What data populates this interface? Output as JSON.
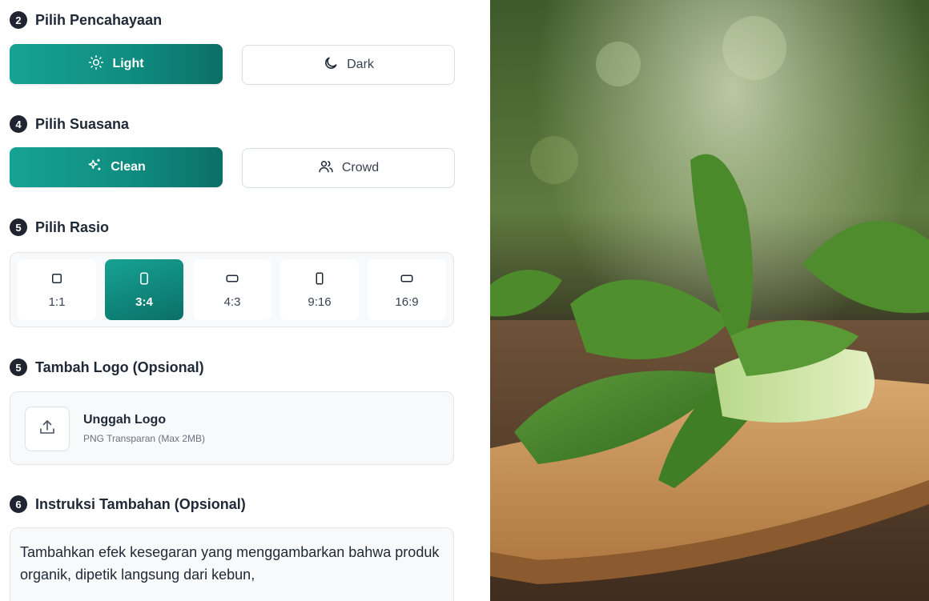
{
  "lighting": {
    "number": "2",
    "title": "Pilih Pencahayaan",
    "options": [
      {
        "label": "Light",
        "icon": "sun-icon",
        "selected": true
      },
      {
        "label": "Dark",
        "icon": "moon-icon",
        "selected": false
      }
    ]
  },
  "mood": {
    "number": "4",
    "title": "Pilih Suasana",
    "options": [
      {
        "label": "Clean",
        "icon": "sparkles-icon",
        "selected": true
      },
      {
        "label": "Crowd",
        "icon": "users-icon",
        "selected": false
      }
    ]
  },
  "ratio": {
    "number": "5",
    "title": "Pilih Rasio",
    "options": [
      {
        "label": "1:1",
        "selected": false
      },
      {
        "label": "3:4",
        "selected": true
      },
      {
        "label": "4:3",
        "selected": false
      },
      {
        "label": "9:16",
        "selected": false
      },
      {
        "label": "16:9",
        "selected": false
      }
    ]
  },
  "logo": {
    "number": "5",
    "title": "Tambah Logo (Opsional)",
    "upload_title": "Unggah Logo",
    "upload_subtitle": "PNG Transparan (Max 2MB)",
    "icon": "upload-icon"
  },
  "instructions": {
    "number": "6",
    "title": "Instruksi Tambahan (Opsional)",
    "value": "Tambahkan efek kesegaran yang menggambarkan bahwa produk organik, dipetik langsung dari kebun,"
  },
  "colors": {
    "accent": "#16a394",
    "accent_dark": "#0b6f66"
  }
}
